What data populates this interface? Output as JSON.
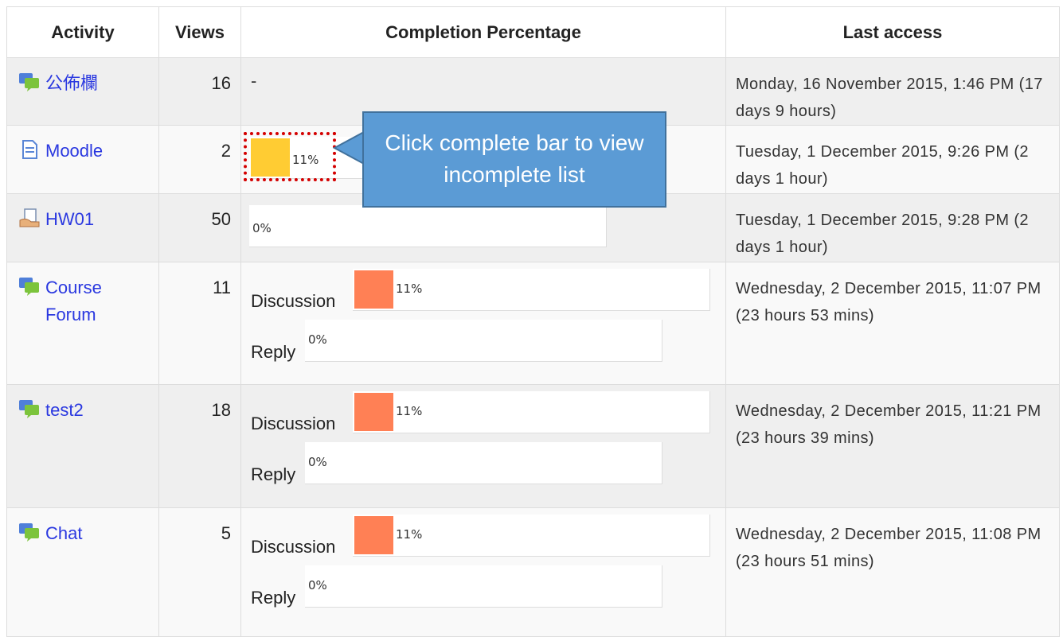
{
  "table": {
    "headers": {
      "activity": "Activity",
      "views": "Views",
      "completion": "Completion Percentage",
      "last_access": "Last access"
    },
    "rows": [
      {
        "activity": "公佈欄",
        "icon": "forum-icon",
        "views": "16",
        "completion": "-",
        "last_access": "Monday, 16 November 2015, 1:46 PM (17 days 9 hours)"
      },
      {
        "activity": "Moodle",
        "icon": "page-icon",
        "views": "2",
        "completion_bar": {
          "value": 0.11,
          "label": "11%",
          "color": "#ffcc33"
        },
        "last_access": "Tuesday, 1 December 2015, 9:26 PM (2 days 1 hour)"
      },
      {
        "activity": "HW01",
        "icon": "assignment-icon",
        "views": "50",
        "completion_bar": {
          "value": 0.0,
          "label": "0%",
          "color": "#ffcc33"
        },
        "last_access": "Tuesday, 1 December 2015, 9:28 PM (2 days 1 hour)"
      },
      {
        "activity": "Course Forum",
        "icon": "forum-icon",
        "views": "11",
        "sub_bars": [
          {
            "label": "Discussion",
            "value": 0.11,
            "pct": "11%",
            "color": "#ff8055"
          },
          {
            "label": "Reply",
            "value": 0.0,
            "pct": "0%",
            "color": "#ff8055"
          }
        ],
        "last_access": "Wednesday, 2 December 2015, 11:07 PM (23 hours 53 mins)"
      },
      {
        "activity": "test2",
        "icon": "forum-icon",
        "views": "18",
        "sub_bars": [
          {
            "label": "Discussion",
            "value": 0.11,
            "pct": "11%",
            "color": "#ff8055"
          },
          {
            "label": "Reply",
            "value": 0.0,
            "pct": "0%",
            "color": "#ff8055"
          }
        ],
        "last_access": "Wednesday, 2 December 2015, 11:21 PM (23 hours 39 mins)"
      },
      {
        "activity": "Chat",
        "icon": "chat-icon",
        "views": "5",
        "sub_bars": [
          {
            "label": "Discussion",
            "value": 0.11,
            "pct": "11%",
            "color": "#ff8055"
          },
          {
            "label": "Reply",
            "value": 0.0,
            "pct": "0%",
            "color": "#ff8055"
          }
        ],
        "last_access": "Wednesday, 2 December 2015, 11:08 PM (23 hours 51 mins)"
      }
    ]
  },
  "callout": {
    "text": "Click complete bar to view incomplete list",
    "color": "#5b9bd5"
  },
  "link_color": "#2a38e0"
}
